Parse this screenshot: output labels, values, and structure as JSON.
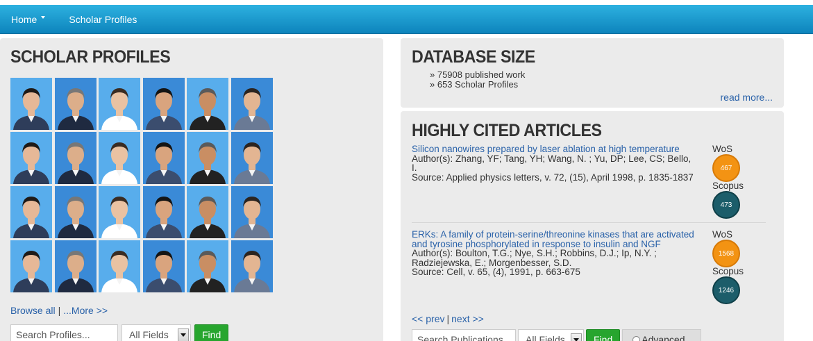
{
  "nav": {
    "home_label": "Home",
    "scholar_profiles_label": "Scholar Profiles"
  },
  "scholars": {
    "title": "SCHOLAR PROFILES",
    "browse_all": "Browse all",
    "separator": "|",
    "more": "...More >>",
    "search_placeholder": "Search Profiles...",
    "field_select": "All Fields",
    "find_label": "Find",
    "photo_count": 24
  },
  "db_size": {
    "title": "DATABASE SIZE",
    "items": [
      "» 75908 published work",
      "» 653 Scholar Profiles"
    ],
    "read_more": "read more..."
  },
  "cited": {
    "title": "HIGHLY CITED ARTICLES",
    "wos_label": "WoS",
    "scopus_label": "Scopus",
    "articles": [
      {
        "title": "Silicon nanowires prepared by laser ablation at high temperature",
        "authors": "Author(s): Zhang, YF; Tang, YH; Wang, N. ; Yu, DP; Lee, CS; Bello, I.",
        "source": "Source: Applied physics letters, v. 72, (15), April 1998, p. 1835-1837",
        "wos": "467",
        "scopus": "473"
      },
      {
        "title": "ERKs: A family of protein-serine/threonine kinases that are activated and tyrosine phosphorylated in response to insulin and NGF",
        "authors": "Author(s): Boulton, T.G.; Nye, S.H.; Robbins, D.J.; Ip, N.Y. ; Radziejewska, E.; Morgenbesser, S.D.",
        "source": "Source: Cell, v. 65, (4), 1991, p. 663-675",
        "wos": "1568",
        "scopus": "1246"
      }
    ],
    "prev": "<< prev",
    "separator": "|",
    "next": "next >>",
    "search_placeholder": "Search Publications",
    "field_select": "All Fields",
    "find_label": "Find",
    "advanced_label": "Advanced"
  },
  "colors": {
    "nav_blue": "#1a9ad0",
    "link_blue": "#2a62a9",
    "find_green": "#27a52e",
    "wos_orange": "#f39313",
    "scopus_teal": "#1c5d6a",
    "panel_gray": "#ebebeb"
  }
}
